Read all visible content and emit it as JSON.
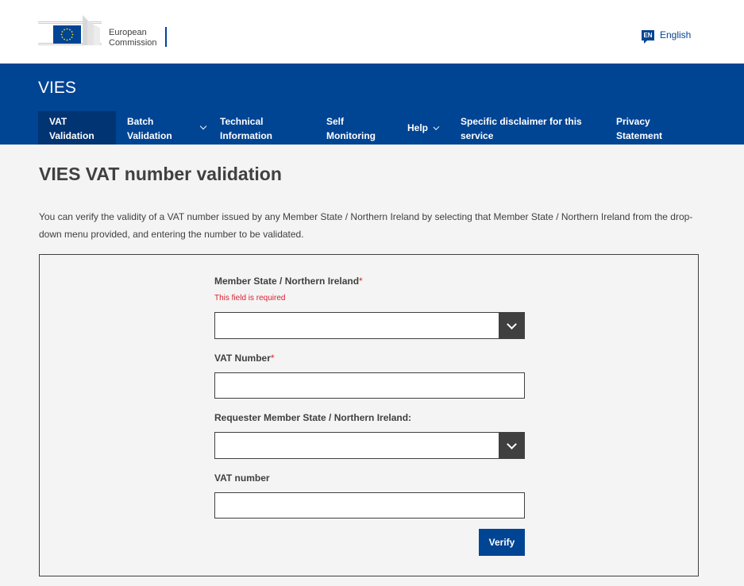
{
  "brand": {
    "line1": "European",
    "line2": "Commission",
    "logo_icon": "eu-flag-icon",
    "flag_color": "#004494",
    "star_color": "#FFDD00"
  },
  "language": {
    "code": "EN",
    "label": "English",
    "icon": "language-icon"
  },
  "site": {
    "title": "VIES"
  },
  "nav": {
    "items": [
      {
        "line1": "VAT",
        "line2": "Validation",
        "active": true
      },
      {
        "line1": "Batch",
        "line2": "Validation",
        "has_dropdown": true
      },
      {
        "line1": "Technical",
        "line2": "Information"
      },
      {
        "line1": "Self",
        "line2": "Monitoring"
      },
      {
        "line1": "Help",
        "has_dropdown": true
      },
      {
        "line1": "Specific disclaimer for this",
        "line2": "service"
      },
      {
        "line1": "Privacy",
        "line2": "Statement"
      }
    ]
  },
  "main": {
    "title": "VIES VAT number validation",
    "intro": "You can verify the validity of a VAT number issued by any Member State / Northern Ireland by selecting that Member State / Northern Ireland from the drop-down menu provided, and entering the number to be validated."
  },
  "form": {
    "member_state_label": "Member State / Northern Ireland",
    "required_marker": "*",
    "error_text": "This field is required",
    "member_state_value": "",
    "vat_number_label": "VAT Number",
    "vat_number_value": "",
    "requester_state_label": "Requester Member State / Northern Ireland:",
    "requester_state_value": "",
    "requester_vat_label": "VAT number",
    "requester_vat_value": "",
    "verify_label": "Verify"
  },
  "colors": {
    "primary": "#004494",
    "primary_dark": "#003473",
    "error": "#da2131",
    "text": "#404040",
    "page_bg": "#f4f4f4"
  }
}
